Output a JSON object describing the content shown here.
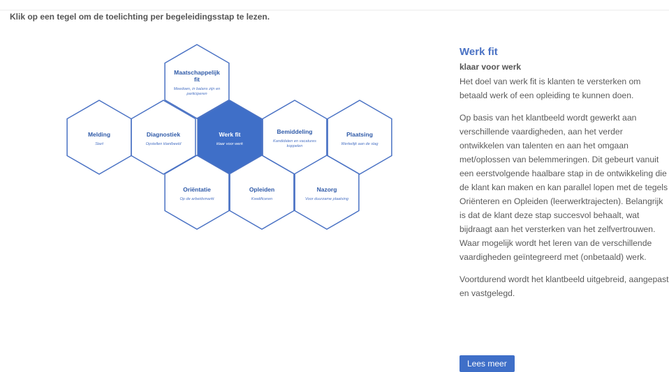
{
  "intro": "Klik op een tegel om de toelichting per begeleidingsstap te lezen.",
  "hexagons": [
    {
      "id": "maatschappelijk",
      "title_line1": "Maatschappelijk",
      "title_line2": "fit",
      "sub_line1": "Meedoen, in balans zijn en",
      "sub_line2": "participeren",
      "active": false
    },
    {
      "id": "melding",
      "title_line1": "Melding",
      "sub_line1": "Start",
      "active": false
    },
    {
      "id": "diagnostiek",
      "title_line1": "Diagnostiek",
      "sub_line1": "Opstellen klantbeeld",
      "active": false
    },
    {
      "id": "werkfit",
      "title_line1": "Werk fit",
      "sub_line1": "klaar voor werk",
      "active": true
    },
    {
      "id": "bemiddeling",
      "title_line1": "Bemiddeling",
      "sub_line1": "Kandidaten en vacatures",
      "sub_line2": "koppelen",
      "active": false
    },
    {
      "id": "plaatsing",
      "title_line1": "Plaatsing",
      "sub_line1": "Werkelijk aan de slag",
      "active": false
    },
    {
      "id": "orientatie",
      "title_line1": "Oriëntatie",
      "sub_line1": "Op de arbeidsmarkt",
      "active": false
    },
    {
      "id": "opleiden",
      "title_line1": "Opleiden",
      "sub_line1": "Kwalificeren",
      "active": false
    },
    {
      "id": "nazorg",
      "title_line1": "Nazorg",
      "sub_line1": "Voor duurzame plaatsing",
      "active": false
    }
  ],
  "panel": {
    "title": "Werk fit",
    "subtitle": "klaar voor werk",
    "paragraph1": "Het doel van werk fit is klanten te versterken om betaald werk of een opleiding te kunnen doen.",
    "paragraph2": "Op basis van het klantbeeld wordt gewerkt aan verschillende vaardigheden, aan het verder ontwikkelen van talenten en aan het omgaan met/oplossen van belemmeringen. Dit gebeurt vanuit een eerstvolgende haalbare stap in de ontwikkeling die de klant kan maken en kan parallel lopen met de tegels Oriënteren en Opleiden (leerwerktrajecten). Belangrijk is dat de klant deze stap succesvol behaalt, wat bijdraagt aan het versterken van het zelfvertrouwen. Waar mogelijk wordt het leren van de verschillende vaardigheden geïntegreerd met (onbetaald) werk.",
    "paragraph3": "Voortdurend wordt het klantbeeld uitgebreid, aangepast en vastgelegd.",
    "button": "Lees meer"
  },
  "colors": {
    "accent": "#3f6fc8",
    "hex_border": "#4a72c4",
    "title_text": "#2f5aa8"
  }
}
